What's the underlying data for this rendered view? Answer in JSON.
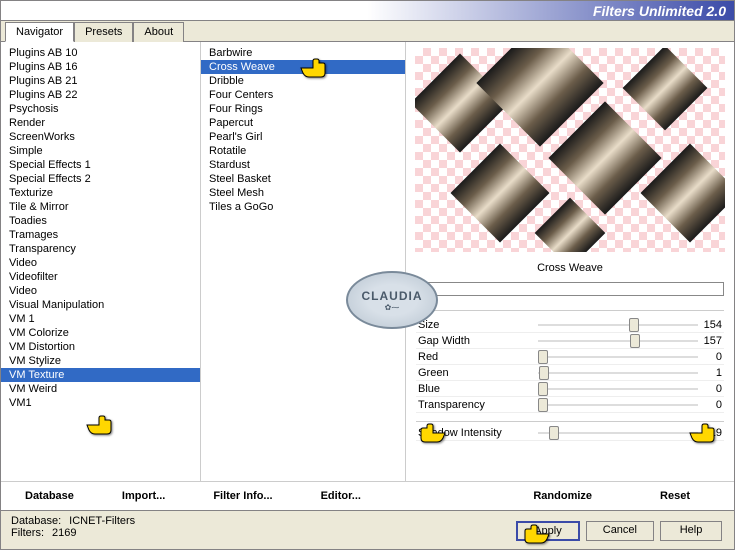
{
  "title": "Filters Unlimited 2.0",
  "tabs": [
    "Navigator",
    "Presets",
    "About"
  ],
  "active_tab": 0,
  "categories": [
    "Plugins AB 10",
    "Plugins AB 16",
    "Plugins AB 21",
    "Plugins AB 22",
    "Psychosis",
    "Render",
    "ScreenWorks",
    "Simple",
    "Special Effects 1",
    "Special Effects 2",
    "Texturize",
    "Tile & Mirror",
    "Toadies",
    "Tramages",
    "Transparency",
    "Video",
    "Videofilter",
    "Video",
    "Visual Manipulation",
    "VM 1",
    "VM Colorize",
    "VM Distortion",
    "VM Stylize",
    "VM Texture",
    "VM Weird",
    "VM1"
  ],
  "selected_category_index": 23,
  "filters": [
    "Barbwire",
    "Cross Weave",
    "Dribble",
    "Four Centers",
    "Four Rings",
    "Papercut",
    "Pearl's Girl",
    "Rotatile",
    "Stardust",
    "Steel Basket",
    "Steel Mesh",
    "Tiles a GoGo"
  ],
  "selected_filter_index": 1,
  "current_filter": "Cross Weave",
  "params": [
    {
      "name": "Size",
      "value": 154
    },
    {
      "name": "Gap Width",
      "value": 157
    },
    {
      "name": "Red",
      "value": 0
    },
    {
      "name": "Green",
      "value": 1
    },
    {
      "name": "Blue",
      "value": 0
    },
    {
      "name": "Transparency",
      "value": 0
    }
  ],
  "shadow_param": {
    "name": "Shadow Intensity",
    "value": 19
  },
  "toolbar": {
    "database": "Database",
    "import": "Import...",
    "filter_info": "Filter Info...",
    "editor": "Editor...",
    "randomize": "Randomize",
    "reset": "Reset"
  },
  "footer": {
    "database_label": "Database:",
    "database_value": "ICNET-Filters",
    "filters_label": "Filters:",
    "filters_value": "2169"
  },
  "buttons": {
    "apply": "Apply",
    "cancel": "Cancel",
    "help": "Help"
  },
  "watermark": "CLAUDIA"
}
